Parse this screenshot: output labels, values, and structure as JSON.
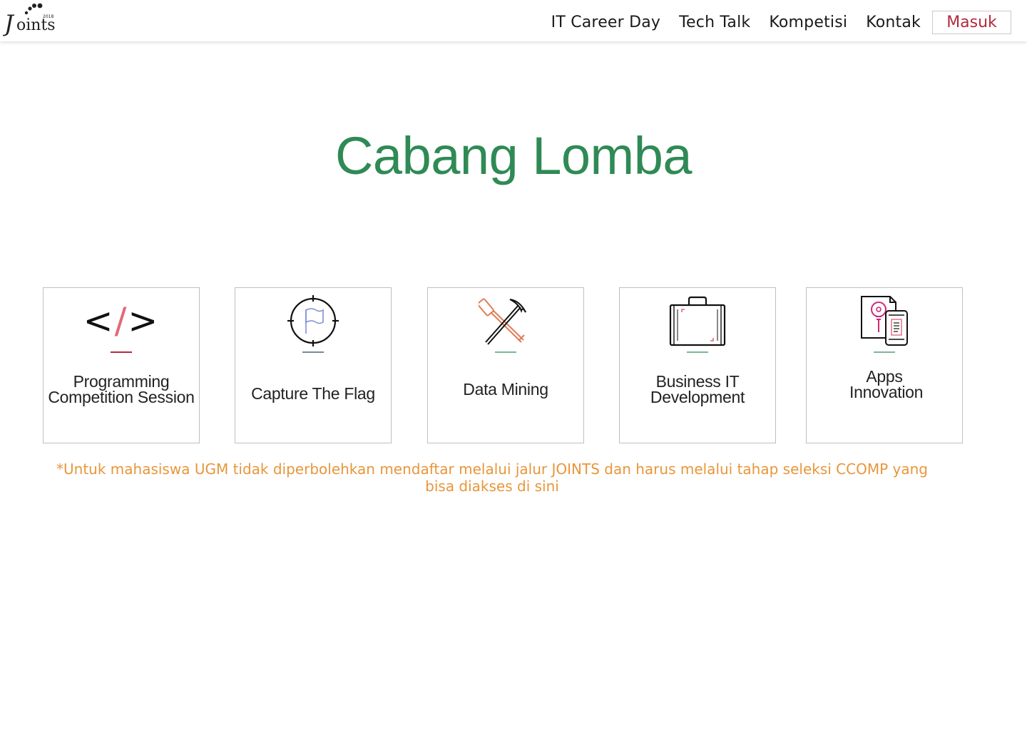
{
  "nav": {
    "logo_alt": "Joints 2018",
    "links": [
      "IT Career Day",
      "Tech Talk",
      "Kompetisi",
      "Kontak"
    ],
    "login_label": "Masuk"
  },
  "main": {
    "title": "Cabang Lomba",
    "cards": [
      {
        "title": "Programming Competition Session",
        "icon": "code-icon"
      },
      {
        "title": "Capture The Flag",
        "icon": "crosshair-flag-icon"
      },
      {
        "title": "Data Mining",
        "icon": "shovel-pickaxe-icon"
      },
      {
        "title": "Business IT Development",
        "icon": "briefcase-icon"
      },
      {
        "title": "Apps Innovation",
        "icon": "idea-phone-icon"
      }
    ],
    "note": "*Untuk mahasiswa UGM tidak diperbolehkan mendaftar melalui jalur JOINTS dan harus melalui tahap seleksi CCOMP yang bisa diakses di sini"
  },
  "colors": {
    "title_green": "#2f8a55",
    "login_red": "#b5293d",
    "note_orange": "#e8963a",
    "accent_pink": "#e06a7a",
    "accent_slate": "#6f8f95",
    "accent_green": "#7ab894"
  }
}
